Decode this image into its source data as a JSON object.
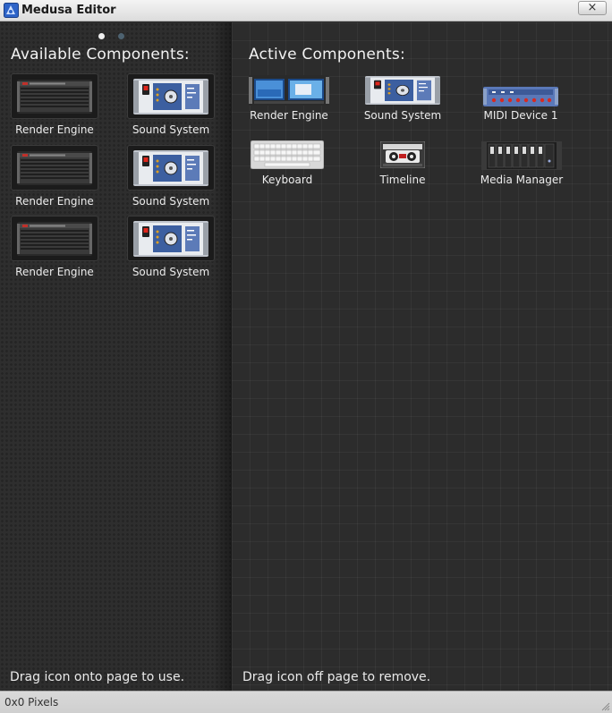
{
  "window": {
    "title": "Medusa Editor",
    "close_symbol": "×"
  },
  "left_panel": {
    "heading": "Available Components:",
    "page_indicator": {
      "pages": 2,
      "current": 1
    },
    "items": [
      {
        "label": "Render Engine",
        "icon": "render-engine-rack-icon"
      },
      {
        "label": "Sound System",
        "icon": "sound-system-rack-icon"
      },
      {
        "label": "Render Engine",
        "icon": "render-engine-rack-icon"
      },
      {
        "label": "Sound System",
        "icon": "sound-system-rack-icon"
      },
      {
        "label": "Render Engine",
        "icon": "render-engine-rack-icon"
      },
      {
        "label": "Sound System",
        "icon": "sound-system-rack-icon"
      }
    ],
    "hint": "Drag icon onto page to use."
  },
  "right_panel": {
    "heading": "Active Components:",
    "items": [
      {
        "label": "Render Engine",
        "icon": "render-engine-screen-icon"
      },
      {
        "label": "Sound System",
        "icon": "sound-system-rack-icon"
      },
      {
        "label": "MIDI Device 1",
        "icon": "midi-device-icon"
      },
      {
        "label": "Keyboard",
        "icon": "keyboard-icon"
      },
      {
        "label": "Timeline",
        "icon": "cassette-icon"
      },
      {
        "label": "Media Manager",
        "icon": "media-manager-icon"
      }
    ],
    "hint": "Drag icon off page to remove."
  },
  "status_bar": {
    "text": "0x0 Pixels"
  }
}
